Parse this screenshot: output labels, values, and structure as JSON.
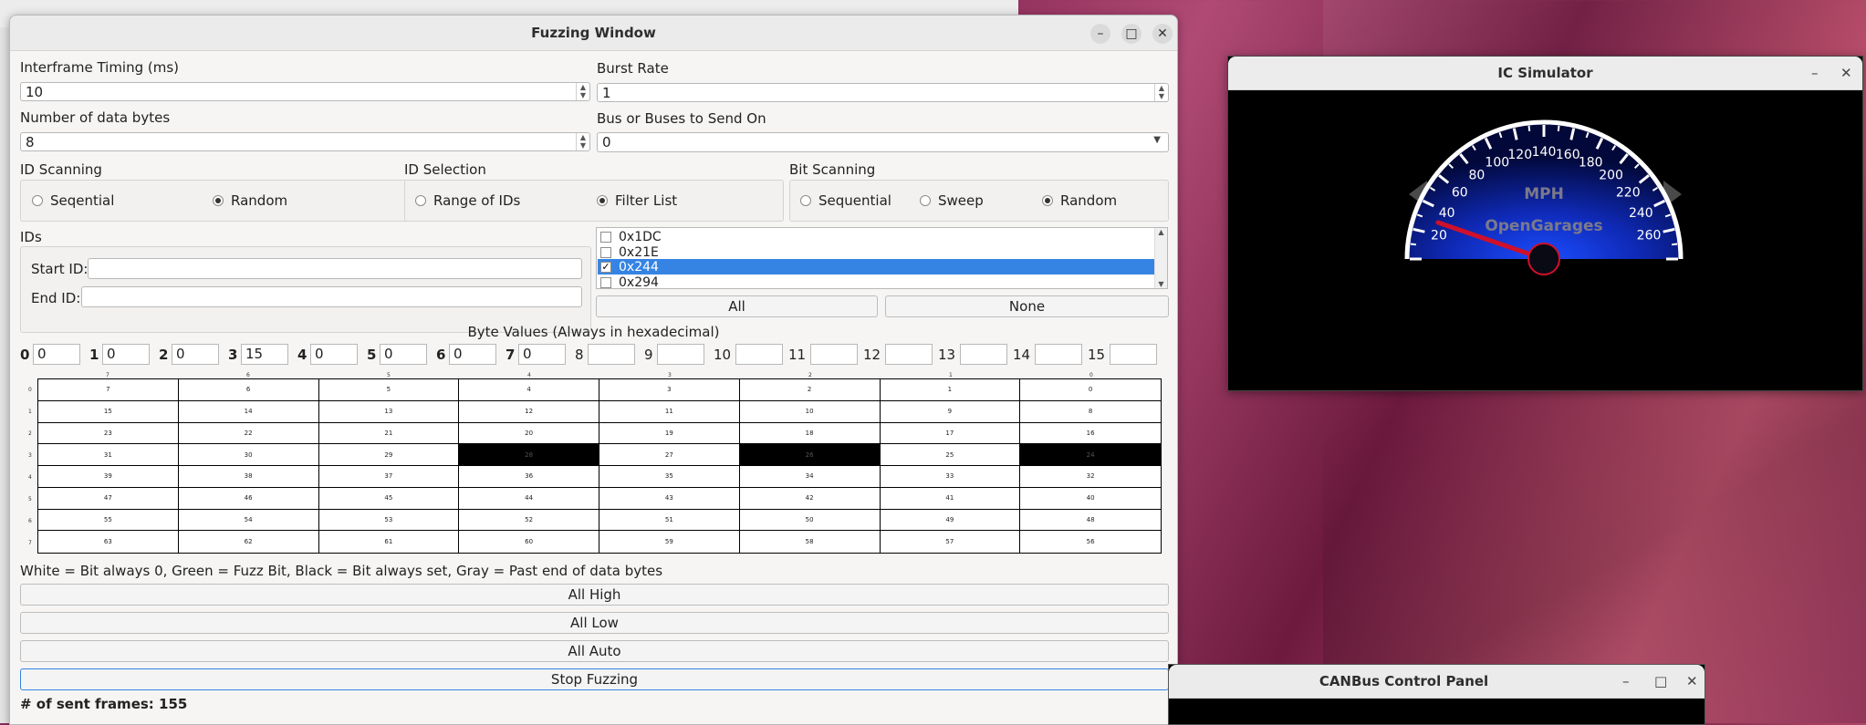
{
  "fuzzing_window": {
    "title": "Fuzzing Window",
    "interframe_label": "Interframe Timing (ms)",
    "interframe_value": "10",
    "burst_label": "Burst Rate",
    "burst_value": "1",
    "num_bytes_label": "Number of data bytes",
    "num_bytes_value": "8",
    "bus_label": "Bus or Buses to Send On",
    "bus_value": "0",
    "id_scanning": {
      "label": "ID Scanning",
      "opt1": "Seqential",
      "opt2": "Random"
    },
    "id_selection": {
      "label": "ID Selection",
      "opt1": "Range of IDs",
      "opt2": "Filter List"
    },
    "bit_scanning": {
      "label": "Bit Scanning",
      "opt1": "Sequential",
      "opt2": "Sweep",
      "opt3": "Random"
    },
    "ids_label": "IDs",
    "start_id_label": "Start ID:",
    "end_id_label": "End ID:",
    "filter_list": [
      {
        "id": "0x1DC",
        "checked": false
      },
      {
        "id": "0x21E",
        "checked": false
      },
      {
        "id": "0x244",
        "checked": true
      },
      {
        "id": "0x294",
        "checked": false
      }
    ],
    "all_button": "All",
    "none_button": "None",
    "byte_values_title": "Byte Values (Always in hexadecimal)",
    "bytes": [
      {
        "label": "0",
        "value": "0"
      },
      {
        "label": "1",
        "value": "0"
      },
      {
        "label": "2",
        "value": "0"
      },
      {
        "label": "3",
        "value": "15"
      },
      {
        "label": "4",
        "value": "0"
      },
      {
        "label": "5",
        "value": "0"
      },
      {
        "label": "6",
        "value": "0"
      },
      {
        "label": "7",
        "value": "0"
      },
      {
        "label": "8",
        "value": ""
      },
      {
        "label": "9",
        "value": ""
      },
      {
        "label": "10",
        "value": ""
      },
      {
        "label": "11",
        "value": ""
      },
      {
        "label": "12",
        "value": ""
      },
      {
        "label": "13",
        "value": ""
      },
      {
        "label": "14",
        "value": ""
      },
      {
        "label": "15",
        "value": ""
      }
    ],
    "bit_grid": [
      [
        "7",
        "6",
        "5",
        "4",
        "3",
        "2",
        "1",
        "0"
      ],
      [
        "15",
        "14",
        "13",
        "12",
        "11",
        "10",
        "9",
        "8"
      ],
      [
        "23",
        "22",
        "21",
        "20",
        "19",
        "18",
        "17",
        "16"
      ],
      [
        "31",
        "30",
        "29",
        "28",
        "27",
        "26",
        "25",
        "24"
      ],
      [
        "39",
        "38",
        "37",
        "36",
        "35",
        "34",
        "33",
        "32"
      ],
      [
        "47",
        "46",
        "45",
        "44",
        "43",
        "42",
        "41",
        "40"
      ],
      [
        "55",
        "54",
        "53",
        "52",
        "51",
        "50",
        "49",
        "48"
      ],
      [
        "63",
        "62",
        "61",
        "60",
        "59",
        "58",
        "57",
        "56"
      ]
    ],
    "black_bits": [
      "28",
      "26",
      "24"
    ],
    "grid_row_labels": [
      "0",
      "1",
      "2",
      "3",
      "4",
      "5",
      "6",
      "7"
    ],
    "grid_col_labels": [
      "7",
      "6",
      "5",
      "4",
      "3",
      "2",
      "1",
      "0"
    ],
    "legend": "White = Bit always 0, Green = Fuzz Bit, Black = Bit always set, Gray = Past end of data bytes",
    "all_high": "All High",
    "all_low": "All Low",
    "all_auto": "All Auto",
    "stop_fuzzing": "Stop Fuzzing",
    "sent_frames": "# of sent frames: 155"
  },
  "ic_simulator": {
    "title": "IC Simulator",
    "unit": "MPH",
    "brand": "OpenGarages",
    "speed_ticks": [
      "20",
      "40",
      "60",
      "80",
      "100",
      "120",
      "140",
      "160",
      "180",
      "200",
      "220",
      "240",
      "260"
    ]
  },
  "canbus_panel": {
    "title": "CANBus Control Panel"
  }
}
